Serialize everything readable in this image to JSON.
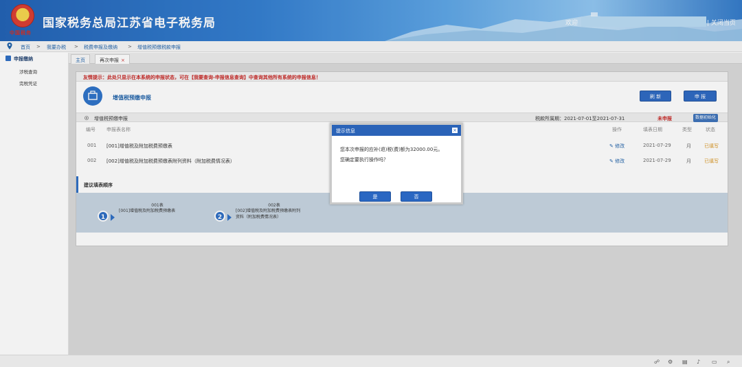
{
  "header": {
    "emblem_text": "中国税务",
    "site_title": "国家税务总局江苏省电子税务局",
    "welcome": "欢迎",
    "close_link": "| 关闭当页"
  },
  "breadcrumb": {
    "items": [
      "首页",
      "我要办税",
      "税费申报及缴纳",
      "增值税预缴税款申报"
    ],
    "separator": ">"
  },
  "sidebar": {
    "section": "申报缴纳",
    "items": [
      "涉税查询",
      "完税凭证"
    ]
  },
  "tabs": [
    {
      "label": "主页",
      "closable": false
    },
    {
      "label": "再次申报",
      "closable": true,
      "close_glyph": "×"
    }
  ],
  "panel": {
    "notice": "友情提示：此处只显示在本系统的申报状态，可在【我要查询-申报信息查询】中查询其他所有系统的申报信息！",
    "declaration_title": "增值税预缴申报",
    "refresh_button": "刷 新",
    "submit_button": "申 报",
    "section_title": "增值税预缴申报",
    "tax_period": "税款所属期：2021-07-01至2021-07-31",
    "status_undeclared": "未申报",
    "init_button": "数据初始化"
  },
  "table": {
    "headers": [
      "编号",
      "申报表名称",
      "操作",
      "填表日期",
      "类型",
      "状态"
    ],
    "rows": [
      {
        "no": "001",
        "name": "[001]增值税及附加税费预缴表",
        "action": "修改",
        "date": "2021-07-29",
        "type": "月",
        "status": "已填写"
      },
      {
        "no": "002",
        "name": "[002]增值税及附加税费预缴表附列资料（附加税费情况表）",
        "action": "修改",
        "date": "2021-07-29",
        "type": "月",
        "status": "已填写"
      }
    ]
  },
  "fill_order": {
    "title": "建议填表顺序",
    "steps": [
      {
        "num": "1",
        "code": "001表",
        "name_lines": [
          "[001]增值税及附加税费预缴表"
        ]
      },
      {
        "num": "2",
        "code": "002表",
        "name_lines": [
          "[002]增值税及附加税费预缴表附列",
          "资料（附加税费情况表）"
        ]
      }
    ]
  },
  "dialog": {
    "title": "提示信息",
    "close_glyph": "×",
    "message_line1": "您本次申报的应补(退)税(费)额为32000.00元。",
    "message_line2": "您确定要执行操作吗？",
    "yes": "是",
    "no": "否"
  },
  "colors": {
    "brand_blue": "#2a67c2",
    "notice_red": "#c6201e",
    "filled_orange": "#d99520"
  }
}
